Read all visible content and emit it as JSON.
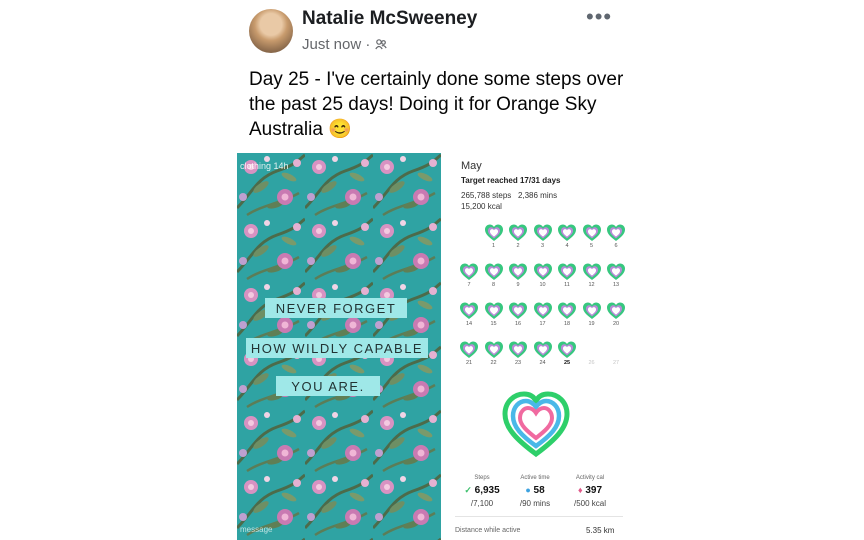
{
  "post": {
    "author": "Natalie McSweeney",
    "time": "Just now",
    "separator": "·",
    "privacy_icon": "friends-icon",
    "more_label": "•••",
    "text": "Day 25 -  I've certainly done some steps over the past 25 days! Doing it for Orange Sky Australia 😊"
  },
  "story": {
    "top_text": "clothing  14h",
    "quote_line1": "NEVER FORGET",
    "quote_line2": "HOW WILDLY CAPABLE",
    "quote_line3": "YOU ARE.",
    "bottom_text": "message",
    "background_color": "#2fa3a3"
  },
  "stats": {
    "month": "May",
    "target": "Target reached 17/31 days",
    "steps_total": "265,788 steps",
    "mins_total": "2,386 mins",
    "kcal_total": "15,200 kcal",
    "today": 25,
    "day_labels": [
      "1",
      "2",
      "3",
      "4",
      "5",
      "6",
      "7",
      "8",
      "9",
      "10",
      "11",
      "12",
      "13",
      "14",
      "15",
      "16",
      "17",
      "18",
      "19",
      "20",
      "21",
      "22",
      "23",
      "24",
      "25",
      "26",
      "27"
    ],
    "metrics": [
      {
        "label": "Steps",
        "value": "6,935",
        "goal": "/7,100",
        "icon": "shoe-icon",
        "color": "#3bbf6b",
        "glyph": "✓"
      },
      {
        "label": "Active time",
        "value": "58",
        "goal": "/90 mins",
        "icon": "clock-icon",
        "color": "#3da2e0",
        "glyph": "●"
      },
      {
        "label": "Activity cal",
        "value": "397",
        "goal": "/500 kcal",
        "icon": "flame-icon",
        "color": "#e05a8a",
        "glyph": "♦"
      }
    ],
    "distance_label": "Distance while active",
    "distance_value": "5.35 km",
    "colors": {
      "steps_ring": "#2ecf6a",
      "time_ring": "#49b8e8",
      "cal_ring": "#f06aa0"
    }
  }
}
